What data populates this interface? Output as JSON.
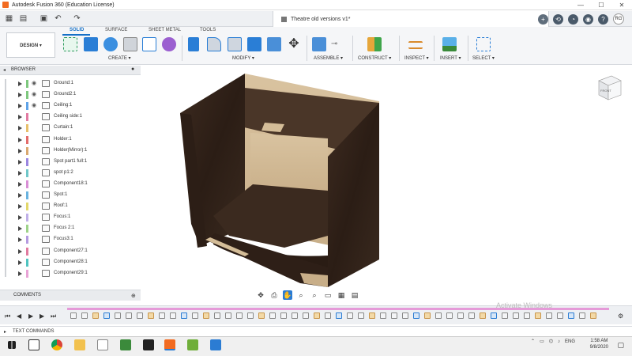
{
  "window": {
    "title": "Autodesk Fusion 360 (Education License)",
    "controls": [
      "—",
      "☐",
      "✕"
    ]
  },
  "document": {
    "tab_title": "Theatre old versions v1*",
    "close_glyph": "✕"
  },
  "quick_access": {
    "avatar_initials": "RG"
  },
  "toolbar": {
    "workspace_button": "DESIGN ▾",
    "tabs": [
      "SOLID",
      "SURFACE",
      "SHEET METAL",
      "TOOLS"
    ],
    "groups": [
      "CREATE ▾",
      "MODIFY ▾",
      "ASSEMBLE ▾",
      "CONSTRUCT ▾",
      "INSPECT ▾",
      "INSERT ▾",
      "SELECT ▾"
    ]
  },
  "browser": {
    "header": "BROWSER",
    "items": [
      {
        "name": "Ground:1",
        "color": "#7ec87e"
      },
      {
        "name": "Ground2:1",
        "color": "#7ec87e"
      },
      {
        "name": "Ceiling:1",
        "color": "#5fa3e8"
      },
      {
        "name": "Ceiling side:1",
        "color": "#e27ba2"
      },
      {
        "name": "Curtain:1",
        "color": "#e8c06b"
      },
      {
        "name": "Holder:1",
        "color": "#e36b6b"
      },
      {
        "name": "Holder(Mirror):1",
        "color": "#d9a86f"
      },
      {
        "name": "Spot part1 full:1",
        "color": "#9a86e0"
      },
      {
        "name": "spot p1:2",
        "color": "#6fc7c9"
      },
      {
        "name": "Component18:1",
        "color": "#d98fd6"
      },
      {
        "name": "Spot:1",
        "color": "#69b3e0"
      },
      {
        "name": "Roof:1",
        "color": "#e3d86b"
      },
      {
        "name": "Focus:1",
        "color": "#c0b0e8"
      },
      {
        "name": "Focus 2:1",
        "color": "#9ed389"
      },
      {
        "name": "Focus3:1",
        "color": "#b49ae0"
      },
      {
        "name": "Component27:1",
        "color": "#e07a9f"
      },
      {
        "name": "Component28:1",
        "color": "#4fc4c0"
      },
      {
        "name": "Component29:1",
        "color": "#e8a3d6"
      }
    ]
  },
  "comments": {
    "label": "COMMENTS"
  },
  "text_commands": {
    "label": "TEXT COMMANDS"
  },
  "timeline": {
    "watermark": "Activate Windows"
  },
  "taskbar": {
    "time": "1:58 AM",
    "date": "9/8/2020",
    "lang": "ENG"
  },
  "viewcube": {
    "face_label": "FRONT"
  }
}
